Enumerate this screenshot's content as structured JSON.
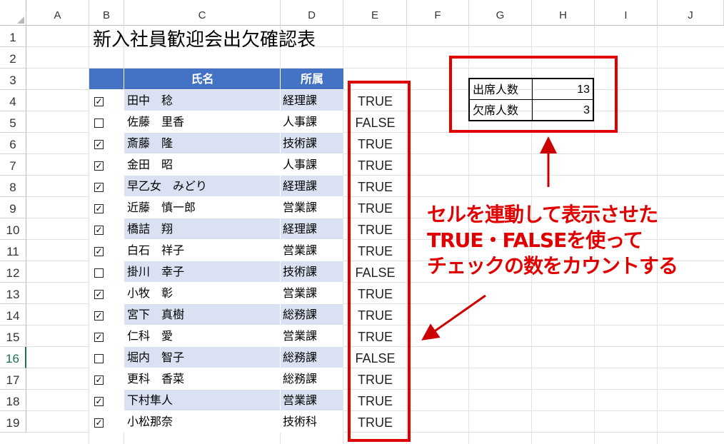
{
  "columns": [
    "A",
    "B",
    "C",
    "D",
    "E",
    "F",
    "G",
    "H",
    "I",
    "J"
  ],
  "rows": [
    "1",
    "2",
    "3",
    "4",
    "5",
    "6",
    "7",
    "8",
    "9",
    "10",
    "11",
    "12",
    "13",
    "14",
    "15",
    "16",
    "17",
    "18",
    "19"
  ],
  "title": "新入社員歓迎会出欠確認表",
  "headers": {
    "name": "氏名",
    "dept": "所属"
  },
  "employees": [
    {
      "name": "田中　稔",
      "dept": "経理課",
      "value": "TRUE",
      "checked": true
    },
    {
      "name": "佐藤　里香",
      "dept": "人事課",
      "value": "FALSE",
      "checked": false
    },
    {
      "name": "斎藤　隆",
      "dept": "技術課",
      "value": "TRUE",
      "checked": true
    },
    {
      "name": "金田　昭",
      "dept": "人事課",
      "value": "TRUE",
      "checked": true
    },
    {
      "name": "早乙女　みどり",
      "dept": "経理課",
      "value": "TRUE",
      "checked": true
    },
    {
      "name": "近藤　慎一郎",
      "dept": "営業課",
      "value": "TRUE",
      "checked": true
    },
    {
      "name": "橋詰　翔",
      "dept": "経理課",
      "value": "TRUE",
      "checked": true
    },
    {
      "name": "白石　祥子",
      "dept": "営業課",
      "value": "TRUE",
      "checked": true
    },
    {
      "name": "掛川　幸子",
      "dept": "技術課",
      "value": "FALSE",
      "checked": false
    },
    {
      "name": "小牧　彰",
      "dept": "営業課",
      "value": "TRUE",
      "checked": true
    },
    {
      "name": "宮下　真樹",
      "dept": "総務課",
      "value": "TRUE",
      "checked": true
    },
    {
      "name": "仁科　愛",
      "dept": "営業課",
      "value": "TRUE",
      "checked": true
    },
    {
      "name": "堀内　智子",
      "dept": "総務課",
      "value": "FALSE",
      "checked": false
    },
    {
      "name": "更科　香菜",
      "dept": "総務課",
      "value": "TRUE",
      "checked": true
    },
    {
      "name": "下村隼人",
      "dept": "営業課",
      "value": "TRUE",
      "checked": true
    },
    {
      "name": "小松那奈",
      "dept": "技術科",
      "value": "TRUE",
      "checked": true
    }
  ],
  "summary": [
    {
      "label": "出席人数",
      "value": "13"
    },
    {
      "label": "欠席人数",
      "value": "3"
    }
  ],
  "annotation": {
    "line1": "セルを連動して表示させた",
    "line2": "TRUE・FALSEを使って",
    "line3": "チェックの数をカウントする"
  },
  "colors": {
    "header_blue": "#4472c4",
    "band_blue": "#d9e1f2",
    "annotation_red": "#e00000",
    "selected_row_green": "#1e7145"
  },
  "selected_row": "16"
}
